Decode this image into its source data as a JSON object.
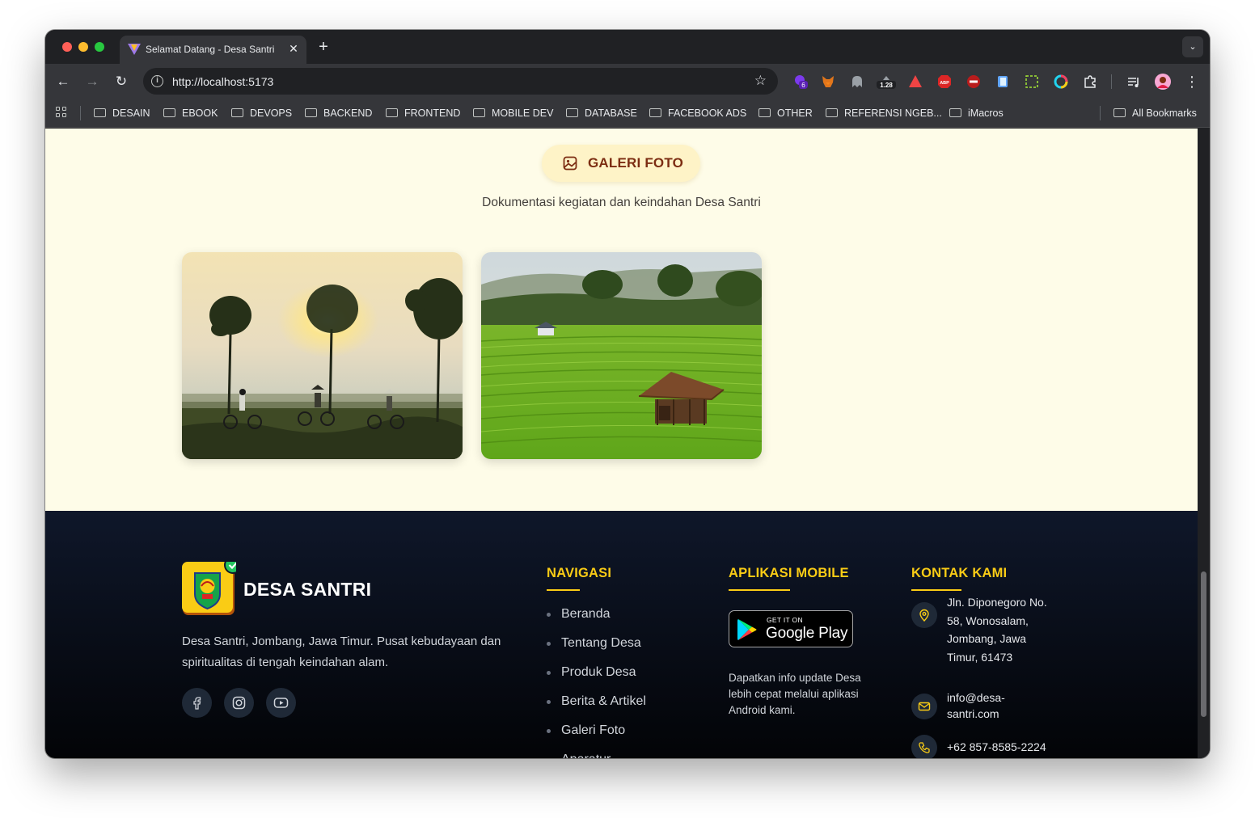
{
  "browser": {
    "tab_title": "Selamat Datang - Desa Santri",
    "new_tab_label": "+",
    "url": "http://localhost:5173",
    "extensions": [
      "extension-purple-6",
      "metamask-fox",
      "extension-ghost",
      "extension-1.28",
      "extension-red-triangle",
      "adblock-plus",
      "extension-minus-red",
      "extension-blue-doc",
      "extension-dashed-select",
      "extension-rainbow-ring",
      "extensions-puzzle",
      "tab-search",
      "profile-avatar",
      "menu-dots"
    ],
    "extension_badges": {
      "purple": "6",
      "gray": "1.28",
      "abp": "ABP"
    },
    "bookmarks": [
      "DESAIN",
      "EBOOK",
      "DEVOPS",
      "BACKEND",
      "FRONTEND",
      "MOBILE DEV",
      "DATABASE",
      "FACEBOOK ADS",
      "OTHER",
      "REFERENSI NGEB...",
      "iMacros"
    ],
    "all_bookmarks": "All Bookmarks"
  },
  "gallery": {
    "badge_label": "GALERI FOTO",
    "subtitle": "Dokumentasi kegiatan dan keindahan Desa Santri",
    "photos": [
      {
        "name": "sunrise-cyclists-photo"
      },
      {
        "name": "rice-terraces-hut-photo"
      }
    ]
  },
  "footer": {
    "brand": "DESA SANTRI",
    "description": "Desa Santri, Jombang, Jawa Timur. Pusat kebudayaan dan spiritualitas di tengah keindahan alam.",
    "social": [
      "facebook",
      "instagram",
      "youtube"
    ],
    "nav_title": "NAVIGASI",
    "nav_items": [
      "Beranda",
      "Tentang Desa",
      "Produk Desa",
      "Berita & Artikel",
      "Galeri Foto",
      "Aparatur"
    ],
    "app_title": "APLIKASI MOBILE",
    "gplay_small": "GET IT ON",
    "gplay_big": "Google Play",
    "app_desc": "Dapatkan info update Desa lebih cepat melalui aplikasi Android kami.",
    "contact_title": "KONTAK KAMI",
    "address_lines": [
      "Jln. Diponegoro No.",
      "58, Wonosalam,",
      "Jombang, Jawa",
      "Timur, 61473"
    ],
    "email_lines": [
      "info@desa-",
      "santri.com"
    ],
    "phone": "+62 857-8585-2224"
  },
  "colors": {
    "accent": "#facc15",
    "page_bg": "#fefce8",
    "footer_bg": "#0f172a",
    "badge_bg": "#fef3c7",
    "badge_text": "#7c2d12"
  }
}
